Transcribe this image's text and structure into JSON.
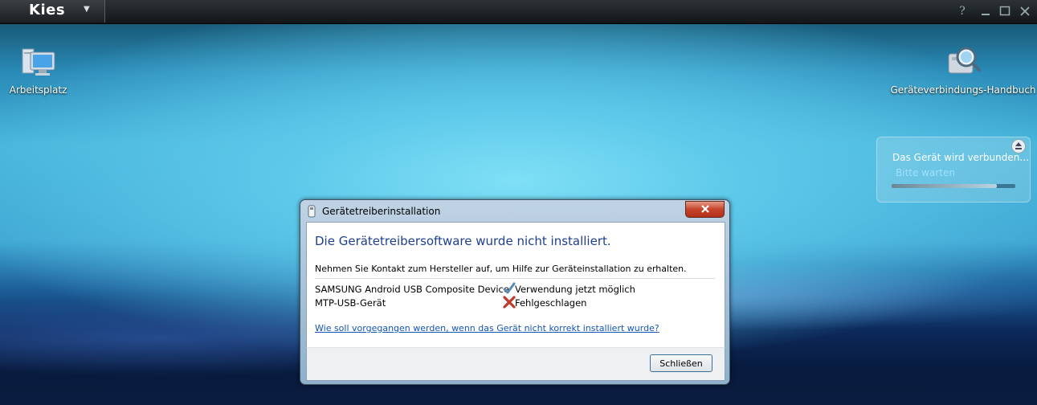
{
  "app": {
    "name": "Kies",
    "window_controls": {
      "help": "?"
    }
  },
  "desktop": {
    "icons": [
      {
        "label": "Arbeitsplatz",
        "icon": "computer-icon"
      },
      {
        "label": "Geräteverbindungs-Handbuch",
        "icon": "manual-search-icon"
      }
    ]
  },
  "notification": {
    "title": "Das Gerät wird verbunden…",
    "subtitle": "Bitte warten",
    "progress": 0.85
  },
  "dialog": {
    "title": "Gerätetreiberinstallation",
    "heading": "Die Gerätetreibersoftware wurde nicht installiert.",
    "message": "Nehmen Sie Kontakt zum Hersteller auf, um Hilfe zur Geräteinstallation zu erhalten.",
    "drivers": [
      {
        "name": "SAMSUNG Android USB Composite Device",
        "status": "Verwendung jetzt möglich",
        "status_icon": "checkmark-icon"
      },
      {
        "name": "MTP-USB-Gerät",
        "status": "Fehlgeschlagen",
        "status_icon": "error-x-icon"
      }
    ],
    "help_link": "Wie soll vorgegangen werden, wenn das Gerät nicht korrekt installiert wurde?",
    "close_button": "Schließen"
  }
}
